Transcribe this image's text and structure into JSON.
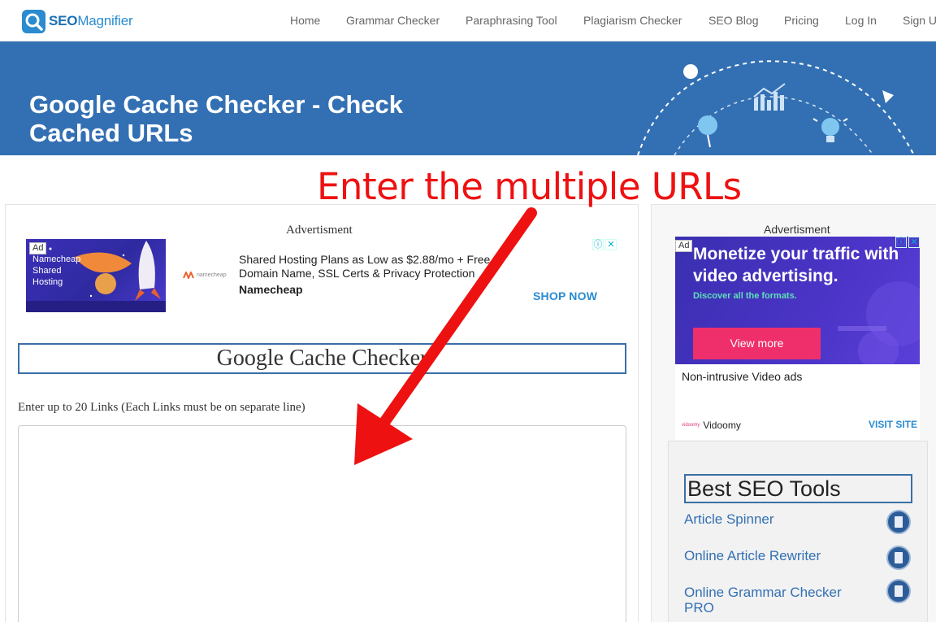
{
  "brand": {
    "seo": "SEO",
    "magnifier": "Magnifier"
  },
  "nav": [
    "Home",
    "Grammar Checker",
    "Paraphrasing Tool",
    "Plagiarism Checker",
    "SEO Blog",
    "Pricing",
    "Log In",
    "Sign Up"
  ],
  "hero": {
    "title": "Google Cache Checker - Check Cached URLs"
  },
  "annotation": {
    "text": "Enter the multiple URLs",
    "color": "#ee1111"
  },
  "left_ad": {
    "label": "Advertisment",
    "badge": "Ad",
    "image_text": "Namecheap\nShared\nHosting",
    "logo_text": "namecheap",
    "copy": "Shared Hosting Plans as Low as $2.88/mo + Free Domain Name, SSL Certs & Privacy Protection",
    "brand": "Namecheap",
    "cta": "SHOP NOW"
  },
  "tool": {
    "title": "Google Cache Checker",
    "links_label": "Enter up to 20 Links (Each Links must be on separate line)",
    "links_value": ""
  },
  "right_ad": {
    "label": "Advertisment",
    "badge": "Ad",
    "headline": "Monetize your traffic with video advertising.",
    "sub": "Discover all the formats.",
    "button": "View more",
    "desc": "Non-intrusive Video ads",
    "brand_logo": "vidoomy",
    "brand": "Vidoomy",
    "visit": "VISIT SITE"
  },
  "best_tools": {
    "title": "Best SEO Tools",
    "items": [
      "Article Spinner",
      "Online Article Rewriter",
      "Online Grammar Checker PRO"
    ]
  },
  "colors": {
    "hero_bg": "#3370b3",
    "accent": "#2a8bd0",
    "title_border": "#3b6ea5"
  }
}
